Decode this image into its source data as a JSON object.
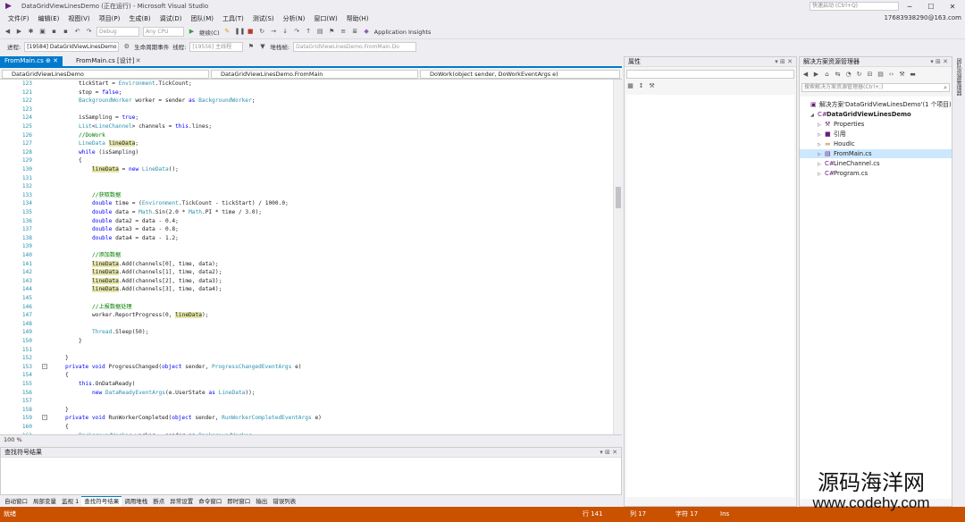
{
  "window": {
    "title": "DataGridViewLinesDemo (正在运行) - Microsoft Visual Studio",
    "quick_launch_placeholder": "快速启动 (Ctrl+Q)",
    "account": "17683938290@163.com",
    "notify_count": "4"
  },
  "menu": [
    "文件(F)",
    "编辑(E)",
    "视图(V)",
    "项目(P)",
    "生成(B)",
    "调试(D)",
    "团队(M)",
    "工具(T)",
    "测试(S)",
    "分析(N)",
    "窗口(W)",
    "帮助(H)"
  ],
  "toolbar": {
    "config": "Debug",
    "platform": "Any CPU",
    "continue_label": "继续(C)",
    "app_insights": "Application Insights"
  },
  "debugbar": {
    "process_label": "进程:",
    "process_value": "[19584] DataGridViewLinesDemo",
    "lifecycle": "生命周期事件",
    "thread_label": "线程:",
    "thread_value": "[19556] 主线程",
    "stack_label": "堆栈帧:",
    "stack_value": "DataGridViewLinesDemo.FromMain.Do"
  },
  "doc_tabs": [
    {
      "label": "FromMain.cs ⊕  ✕",
      "active": true
    },
    {
      "label": "FromMain.cs [设计]",
      "active": false
    }
  ],
  "navbar": {
    "project": "DataGridViewLinesDemo",
    "class": "DataGridViewLinesDemo.FromMain",
    "member": "DoWork(object sender, DoWorkEventArgs e)"
  },
  "code": {
    "lines": [
      {
        "n": "123",
        "t": "tickStart = Environment.TickCount;",
        "i": 4
      },
      {
        "n": "121",
        "t": "stop = false;",
        "i": 4
      },
      {
        "n": "122",
        "t": "BackgroundWorker worker = sender as BackgroundWorker;",
        "i": 4
      },
      {
        "n": "123",
        "t": "",
        "i": 0
      },
      {
        "n": "124",
        "t": "isSampling = true;",
        "i": 4
      },
      {
        "n": "125",
        "t": "List<LineChannel> channels = this.lines;",
        "i": 4
      },
      {
        "n": "126",
        "t": "//DoWork",
        "i": 4,
        "c": "cm"
      },
      {
        "n": "127",
        "t": "LineData lineData;",
        "i": 4
      },
      {
        "n": "128",
        "t": "while (isSampling)",
        "i": 4
      },
      {
        "n": "129",
        "t": "{",
        "i": 4
      },
      {
        "n": "130",
        "t": "lineData = new LineData();",
        "i": 6
      },
      {
        "n": "131",
        "t": "",
        "i": 0
      },
      {
        "n": "132",
        "t": "",
        "i": 0
      },
      {
        "n": "133",
        "t": "//获取数据",
        "i": 6,
        "c": "cm"
      },
      {
        "n": "134",
        "t": "double time = (Environment.TickCount - tickStart) / 1000.0;",
        "i": 6
      },
      {
        "n": "135",
        "t": "double data = Math.Sin(2.0 * Math.PI * time / 3.0);",
        "i": 6
      },
      {
        "n": "136",
        "t": "double data2 = data - 0.4;",
        "i": 6
      },
      {
        "n": "137",
        "t": "double data3 = data - 0.8;",
        "i": 6
      },
      {
        "n": "138",
        "t": "double data4 = data - 1.2;",
        "i": 6
      },
      {
        "n": "139",
        "t": "",
        "i": 0
      },
      {
        "n": "140",
        "t": "//添加数据",
        "i": 6,
        "c": "cm"
      },
      {
        "n": "141",
        "t": "lineData.Add(channels[0], time, data);",
        "i": 6
      },
      {
        "n": "142",
        "t": "lineData.Add(channels[1], time, data2);",
        "i": 6
      },
      {
        "n": "143",
        "t": "lineData.Add(channels[2], time, data3);",
        "i": 6
      },
      {
        "n": "144",
        "t": "lineData.Add(channels[3], time, data4);",
        "i": 6
      },
      {
        "n": "145",
        "t": "",
        "i": 0
      },
      {
        "n": "146",
        "t": "//上报数据处理",
        "i": 6,
        "c": "cm"
      },
      {
        "n": "147",
        "t": "worker.ReportProgress(0, lineData);",
        "i": 6
      },
      {
        "n": "148",
        "t": "",
        "i": 0
      },
      {
        "n": "149",
        "t": "Thread.Sleep(50);",
        "i": 6
      },
      {
        "n": "150",
        "t": "}",
        "i": 4
      },
      {
        "n": "151",
        "t": "",
        "i": 0
      },
      {
        "n": "152",
        "t": "}",
        "i": 2
      },
      {
        "n": "153",
        "t": "private void ProgressChanged(object sender, ProgressChangedEventArgs e)",
        "i": 2
      },
      {
        "n": "154",
        "t": "{",
        "i": 2
      },
      {
        "n": "155",
        "t": "this.OnDataReady(",
        "i": 4
      },
      {
        "n": "156",
        "t": "new DataReadyEventArgs(e.UserState as LineData));",
        "i": 6
      },
      {
        "n": "157",
        "t": "",
        "i": 0
      },
      {
        "n": "158",
        "t": "}",
        "i": 2
      },
      {
        "n": "159",
        "t": "private void RunWorkerCompleted(object sender, RunWorkerCompletedEventArgs e)",
        "i": 2
      },
      {
        "n": "160",
        "t": "{",
        "i": 2
      },
      {
        "n": "161",
        "t": "BackgroundWorker worker = sender as BackgroundWorker;",
        "i": 4
      },
      {
        "n": "162",
        "t": "",
        "i": 0
      },
      {
        "n": "163",
        "t": "worker.DoWork -= new DoWorkEventHandler(DoWork);",
        "i": 4
      }
    ]
  },
  "zoom": "100 %",
  "find_panel": {
    "title": "查找符号结果"
  },
  "bottom_tabs": [
    "自动窗口",
    "局部变量",
    "监视 1",
    "查找符号结果",
    "调用堆栈",
    "断点",
    "异常设置",
    "命令窗口",
    "即时窗口",
    "输出",
    "错误列表"
  ],
  "properties": {
    "title": "属性"
  },
  "solution": {
    "title": "解决方案资源管理器",
    "search_placeholder": "搜索解决方案资源管理器(Ctrl+;)",
    "items": [
      {
        "label": "解决方案'DataGridViewLinesDemo'(1 个项目)",
        "level": 0,
        "icon": "solution-icon",
        "tri": ""
      },
      {
        "label": "DataGridViewLinesDemo",
        "level": 1,
        "icon": "csproj-icon",
        "tri": "◢"
      },
      {
        "label": "Properties",
        "level": 2,
        "icon": "wrench-icon",
        "tri": "▷"
      },
      {
        "label": "引用",
        "level": 2,
        "icon": "reference-icon",
        "tri": "▷"
      },
      {
        "label": "HoudIc",
        "level": 2,
        "icon": "folder-icon",
        "tri": "▷"
      },
      {
        "label": "FromMain.cs",
        "level": 2,
        "icon": "form-icon",
        "tri": "▷",
        "selected": true
      },
      {
        "label": "LineChannel.cs",
        "level": 2,
        "icon": "csharp-icon",
        "tri": "▷"
      },
      {
        "label": "Program.cs",
        "level": 2,
        "icon": "csharp-icon",
        "tri": "▷"
      }
    ]
  },
  "side_strip": "团队资源管理器",
  "status": {
    "left": "就绪",
    "row": "行 141",
    "col": "列 17",
    "ch": "字符 17",
    "ins": "Ins"
  },
  "watermark": {
    "cn": "源码海洋网",
    "url": "www.codehy.com"
  }
}
